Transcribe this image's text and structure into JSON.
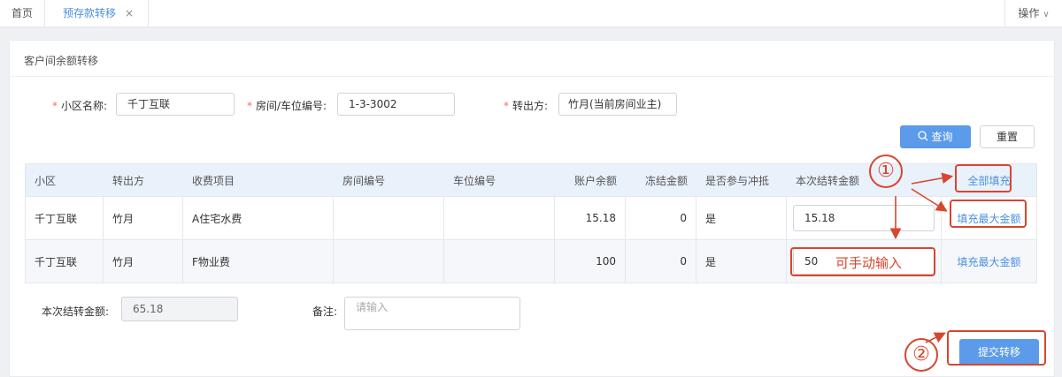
{
  "tabs": {
    "home": "首页",
    "active": "预存款转移",
    "close": "×",
    "ops": "操作",
    "ops_chevron": "∨"
  },
  "card": {
    "title": "客户间余额转移"
  },
  "form": {
    "required_mark": "*",
    "community_label": "小区名称:",
    "community_value": "千丁互联",
    "room_label": "房间/车位编号:",
    "room_value": "1-3-3002",
    "from_label": "转出方:",
    "from_value": "竹月(当前房间业主)",
    "search_icon": "search-icon",
    "search_label": "查询",
    "reset_label": "重置"
  },
  "table": {
    "headers": [
      "小区",
      "转出方",
      "收费项目",
      "房间编号",
      "车位编号",
      "账户余额",
      "冻结金额",
      "是否参与冲抵",
      "本次结转金额"
    ],
    "fill_all": "全部填充",
    "rows": [
      {
        "community": "千丁互联",
        "from": "竹月",
        "item": "A住宅水费",
        "room": "",
        "parking": "",
        "balance": "15.18",
        "frozen": "0",
        "offset": "是",
        "amount": "15.18",
        "action": "填充最大金额"
      },
      {
        "community": "千丁互联",
        "from": "竹月",
        "item": "F物业费",
        "room": "",
        "parking": "",
        "balance": "100",
        "frozen": "0",
        "offset": "是",
        "amount": "50",
        "action": "填充最大金额"
      }
    ]
  },
  "footer": {
    "total_label": "本次结转金额:",
    "total_value": "65.18",
    "remark_label": "备注:",
    "remark_placeholder": "请输入",
    "submit_label": "提交转移"
  },
  "annotations": {
    "circle_1": "①",
    "circle_2": "②",
    "manual_text": "可手动输入",
    "color": "#d9452e"
  }
}
